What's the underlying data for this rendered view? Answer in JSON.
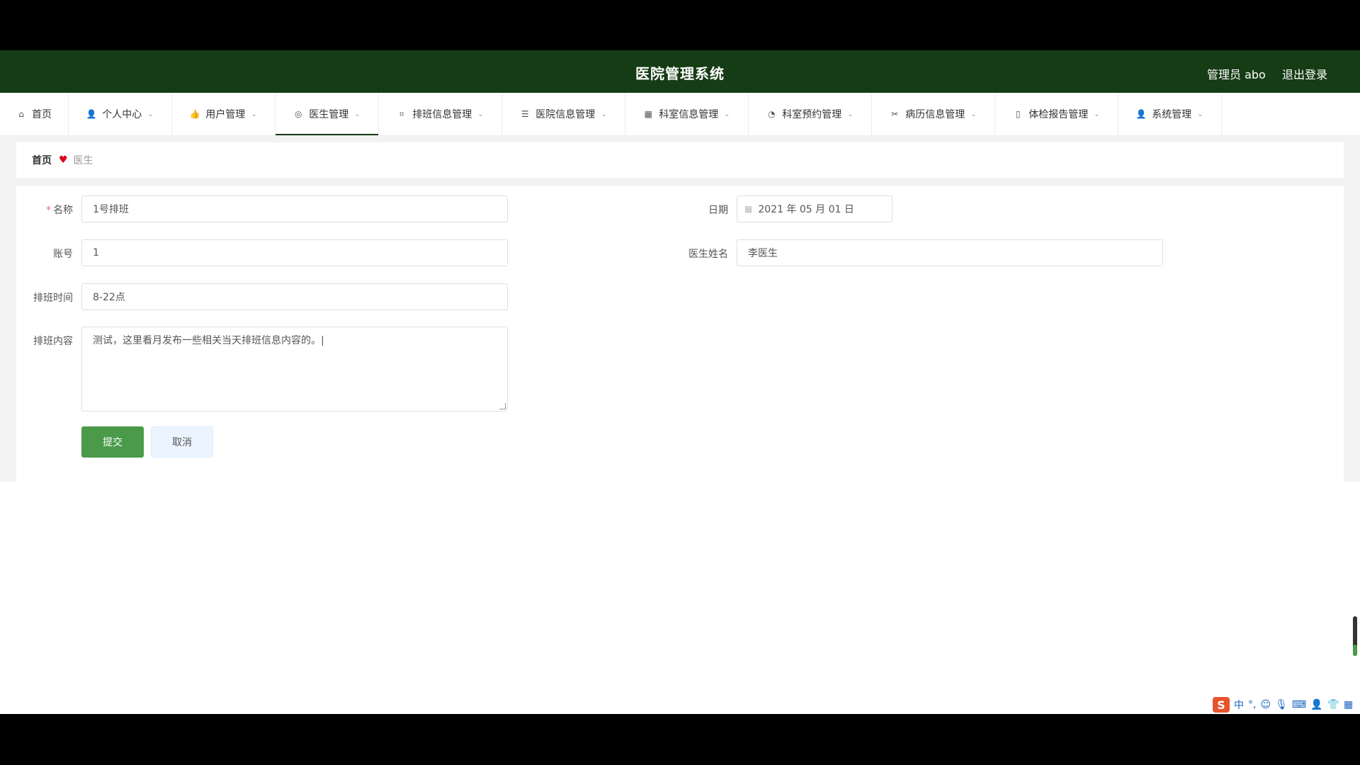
{
  "header": {
    "title": "医院管理系统",
    "user": "管理员 abo",
    "logout": "退出登录"
  },
  "nav": [
    {
      "label": "首页",
      "icon": "home-icon",
      "width": 97
    },
    {
      "label": "个人中心",
      "icon": "user-icon",
      "width": 146
    },
    {
      "label": "用户管理",
      "icon": "thumb-icon",
      "width": 146
    },
    {
      "label": "医生管理",
      "icon": "at-icon",
      "width": 146,
      "active": true
    },
    {
      "label": "排班信息管理",
      "icon": "crop-icon",
      "width": 174
    },
    {
      "label": "医院信息管理",
      "icon": "sliders-icon",
      "width": 174
    },
    {
      "label": "科室信息管理",
      "icon": "grid-icon",
      "width": 174
    },
    {
      "label": "科室预约管理",
      "icon": "gauge-icon",
      "width": 174
    },
    {
      "label": "病历信息管理",
      "icon": "ticket-icon",
      "width": 174
    },
    {
      "label": "体检报告管理",
      "icon": "phone-icon",
      "width": 174
    },
    {
      "label": "系统管理",
      "icon": "user-icon",
      "width": 146
    }
  ],
  "breadcrumb": {
    "home": "首页",
    "current": "医生"
  },
  "form": {
    "name_label": "名称",
    "name_value": "1号排班",
    "account_label": "账号",
    "account_value": "1",
    "time_label": "排班时间",
    "time_value": "8-22点",
    "content_label": "排班内容",
    "content_value": "测试，这里看月发布一些相关当天排班信息内容的。|",
    "date_label": "日期",
    "date_value": "2021 年 05 月 01 日",
    "doctor_label": "医生姓名",
    "doctor_value": "李医生",
    "submit": "提交",
    "cancel": "取消"
  },
  "ime": {
    "logo": "S",
    "mode": "中"
  },
  "colors": {
    "header_bg": "#163c16",
    "primary": "#4a9a4a",
    "heart": "#d9001b"
  }
}
